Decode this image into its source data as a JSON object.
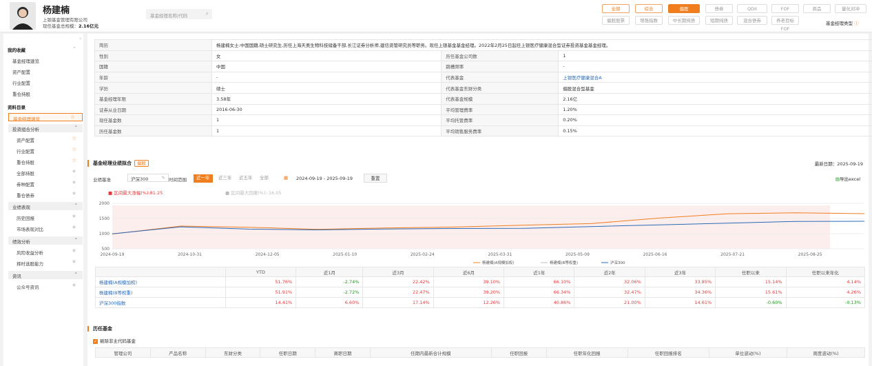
{
  "header": {
    "name": "杨建楠",
    "company": "上银基金管理有限公司",
    "scale_label": "现任基金总规模：",
    "scale_value": "2.16亿元",
    "search_placeholder": "基金经理名称/代码"
  },
  "types": {
    "row1": [
      "全部",
      "综合",
      "偏股",
      "债券",
      "QDII",
      "FOF",
      "商品",
      "量化对冲"
    ],
    "row2": [
      "偏股股票",
      "增强指数",
      "中长期纯债",
      "短期纯债",
      "混合债券",
      "养老目标FOF"
    ],
    "manager_type": "基金经理类型"
  },
  "sidebar": {
    "h1": "我的收藏",
    "fav": [
      "基金经理速览",
      "资产配置",
      "行业配置",
      "重仓持股"
    ],
    "h2": "资料目录",
    "sel": "基金经理速览",
    "g1": "投资组合分析",
    "g1items": [
      "资产配置",
      "行业配置",
      "重仓持股",
      "全部持股",
      "券种配置",
      "重仓债券"
    ],
    "g2": "业绩表现",
    "g2items": [
      "历史回报",
      "市场表现对比"
    ],
    "g3": "绩效分析",
    "g3items": [
      "风险收益分析",
      "择时选股能力"
    ],
    "g4": "资讯",
    "g4items": [
      "公众号资讯"
    ]
  },
  "info": {
    "intro_k": "简历",
    "intro_v": "杨建楠女士:中国国籍,硕士研究生,历任上海天奥生物科技储备干部,长江证券分析师,建信资管研究员等职务。现任上银基金基金经理。2022年2月25日起任上银医疗健康混合型证券投资基金基金经理。",
    "rows": [
      [
        "性别",
        "女",
        "历任基金公司数",
        "1"
      ],
      [
        "国籍",
        "中国",
        "跳槽频率",
        "-"
      ],
      [
        "年龄",
        "-",
        "代表基金",
        "上银医疗健康混合A"
      ],
      [
        "学历",
        "硕士",
        "代表基金东财分类",
        "偏股混合型基金"
      ],
      [
        "基金经理年限",
        "3.58年",
        "代表基金规模",
        "2.16亿"
      ],
      [
        "证券从业日期",
        "2016-06-30",
        "平均管理费率",
        "1.20%"
      ],
      [
        "现任基金数",
        "1",
        "平均托管费率",
        "0.20%"
      ],
      [
        "历任基金数",
        "1",
        "平均销售服务费率",
        "0.15%"
      ]
    ]
  },
  "perf_section": {
    "title": "基金经理业绩拟合",
    "tag": "偏股",
    "latest": "最新日期：2025-09-19",
    "bench_label": "业绩基准",
    "bench_value": "沪深300",
    "range_label": "时间范围",
    "ranges": [
      "近一年",
      "近三年",
      "近五年",
      "全部"
    ],
    "date_range": "2024-09-19  -  2025-09-19",
    "reset": "重置",
    "export": "导出excel",
    "dd_label": "区间最大涨幅(%):81.25",
    "dd2_label": "区间最大回撤(%):-16.05"
  },
  "chart_data": {
    "type": "line",
    "x": [
      "2024-09-19",
      "2024-10-31",
      "2024-12-05",
      "2025-01-10",
      "2025-02-24",
      "2025-03-31",
      "2025-05-09",
      "2025-06-16",
      "2025-07-21",
      "2025-08-25"
    ],
    "yticks": [
      "2000",
      "1500",
      "1000",
      "500"
    ],
    "ylim": [
      500,
      2000
    ],
    "series": [
      {
        "name": "杨建楠(A规模加权)",
        "color": "#f07d1e",
        "values": [
          1000,
          1250,
          1200,
          1150,
          1180,
          1230,
          1280,
          1320,
          1520,
          1650,
          1700,
          1660
        ]
      },
      {
        "name": "杨建楠(B等权重)",
        "color": "#bbbbbb",
        "values": [
          1000,
          1250,
          1200,
          1150,
          1180,
          1230,
          1280,
          1320,
          1520,
          1650,
          1700,
          1660
        ]
      },
      {
        "name": "沪深300",
        "color": "#2a6ab5",
        "values": [
          1000,
          1220,
          1150,
          1130,
          1150,
          1170,
          1180,
          1230,
          1290,
          1350,
          1400,
          1410
        ]
      }
    ]
  },
  "perf_table": {
    "headers": [
      "",
      "YTD",
      "近1月",
      "近3月",
      "近6月",
      "近1年",
      "近2年",
      "近3年",
      "任职以来",
      "任职以来年化"
    ],
    "rows": [
      [
        "杨建楠(A规模加权)",
        "51.76%",
        "-2.74%",
        "22.42%",
        "39.10%",
        "66.10%",
        "32.06%",
        "33.85%",
        "15.14%",
        "4.14%"
      ],
      [
        "杨建楠(B等权重)",
        "51.91%",
        "-2.72%",
        "22.47%",
        "39.20%",
        "66.34%",
        "32.47%",
        "34.36%",
        "15.61%",
        "4.26%"
      ],
      [
        "沪深300指数",
        "14.41%",
        "6.60%",
        "17.14%",
        "12.26%",
        "40.86%",
        "21.00%",
        "14.61%",
        "-0.60%",
        "-0.13%"
      ]
    ]
  },
  "hist": {
    "title": "历任基金",
    "filter": "剔除非主代码基金",
    "headers": [
      "管理公司",
      "产品名称",
      "东财分类",
      "任职日期",
      "离职日期",
      "任期内最新合计规模",
      "任职回报",
      "任职年化回报",
      "任职回报排名",
      "单位波动(%)",
      "周度波动(%)"
    ]
  }
}
